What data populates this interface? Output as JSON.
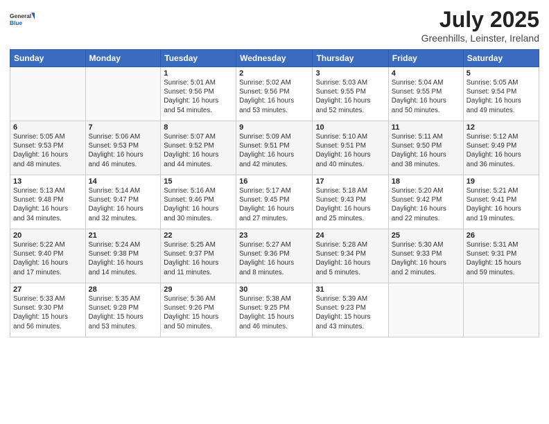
{
  "header": {
    "month_title": "July 2025",
    "location": "Greenhills, Leinster, Ireland"
  },
  "columns": [
    "Sunday",
    "Monday",
    "Tuesday",
    "Wednesday",
    "Thursday",
    "Friday",
    "Saturday"
  ],
  "weeks": [
    [
      {
        "day": "",
        "detail": ""
      },
      {
        "day": "",
        "detail": ""
      },
      {
        "day": "1",
        "detail": "Sunrise: 5:01 AM\nSunset: 9:56 PM\nDaylight: 16 hours\nand 54 minutes."
      },
      {
        "day": "2",
        "detail": "Sunrise: 5:02 AM\nSunset: 9:56 PM\nDaylight: 16 hours\nand 53 minutes."
      },
      {
        "day": "3",
        "detail": "Sunrise: 5:03 AM\nSunset: 9:55 PM\nDaylight: 16 hours\nand 52 minutes."
      },
      {
        "day": "4",
        "detail": "Sunrise: 5:04 AM\nSunset: 9:55 PM\nDaylight: 16 hours\nand 50 minutes."
      },
      {
        "day": "5",
        "detail": "Sunrise: 5:05 AM\nSunset: 9:54 PM\nDaylight: 16 hours\nand 49 minutes."
      }
    ],
    [
      {
        "day": "6",
        "detail": "Sunrise: 5:05 AM\nSunset: 9:53 PM\nDaylight: 16 hours\nand 48 minutes."
      },
      {
        "day": "7",
        "detail": "Sunrise: 5:06 AM\nSunset: 9:53 PM\nDaylight: 16 hours\nand 46 minutes."
      },
      {
        "day": "8",
        "detail": "Sunrise: 5:07 AM\nSunset: 9:52 PM\nDaylight: 16 hours\nand 44 minutes."
      },
      {
        "day": "9",
        "detail": "Sunrise: 5:09 AM\nSunset: 9:51 PM\nDaylight: 16 hours\nand 42 minutes."
      },
      {
        "day": "10",
        "detail": "Sunrise: 5:10 AM\nSunset: 9:51 PM\nDaylight: 16 hours\nand 40 minutes."
      },
      {
        "day": "11",
        "detail": "Sunrise: 5:11 AM\nSunset: 9:50 PM\nDaylight: 16 hours\nand 38 minutes."
      },
      {
        "day": "12",
        "detail": "Sunrise: 5:12 AM\nSunset: 9:49 PM\nDaylight: 16 hours\nand 36 minutes."
      }
    ],
    [
      {
        "day": "13",
        "detail": "Sunrise: 5:13 AM\nSunset: 9:48 PM\nDaylight: 16 hours\nand 34 minutes."
      },
      {
        "day": "14",
        "detail": "Sunrise: 5:14 AM\nSunset: 9:47 PM\nDaylight: 16 hours\nand 32 minutes."
      },
      {
        "day": "15",
        "detail": "Sunrise: 5:16 AM\nSunset: 9:46 PM\nDaylight: 16 hours\nand 30 minutes."
      },
      {
        "day": "16",
        "detail": "Sunrise: 5:17 AM\nSunset: 9:45 PM\nDaylight: 16 hours\nand 27 minutes."
      },
      {
        "day": "17",
        "detail": "Sunrise: 5:18 AM\nSunset: 9:43 PM\nDaylight: 16 hours\nand 25 minutes."
      },
      {
        "day": "18",
        "detail": "Sunrise: 5:20 AM\nSunset: 9:42 PM\nDaylight: 16 hours\nand 22 minutes."
      },
      {
        "day": "19",
        "detail": "Sunrise: 5:21 AM\nSunset: 9:41 PM\nDaylight: 16 hours\nand 19 minutes."
      }
    ],
    [
      {
        "day": "20",
        "detail": "Sunrise: 5:22 AM\nSunset: 9:40 PM\nDaylight: 16 hours\nand 17 minutes."
      },
      {
        "day": "21",
        "detail": "Sunrise: 5:24 AM\nSunset: 9:38 PM\nDaylight: 16 hours\nand 14 minutes."
      },
      {
        "day": "22",
        "detail": "Sunrise: 5:25 AM\nSunset: 9:37 PM\nDaylight: 16 hours\nand 11 minutes."
      },
      {
        "day": "23",
        "detail": "Sunrise: 5:27 AM\nSunset: 9:36 PM\nDaylight: 16 hours\nand 8 minutes."
      },
      {
        "day": "24",
        "detail": "Sunrise: 5:28 AM\nSunset: 9:34 PM\nDaylight: 16 hours\nand 5 minutes."
      },
      {
        "day": "25",
        "detail": "Sunrise: 5:30 AM\nSunset: 9:33 PM\nDaylight: 16 hours\nand 2 minutes."
      },
      {
        "day": "26",
        "detail": "Sunrise: 5:31 AM\nSunset: 9:31 PM\nDaylight: 15 hours\nand 59 minutes."
      }
    ],
    [
      {
        "day": "27",
        "detail": "Sunrise: 5:33 AM\nSunset: 9:30 PM\nDaylight: 15 hours\nand 56 minutes."
      },
      {
        "day": "28",
        "detail": "Sunrise: 5:35 AM\nSunset: 9:28 PM\nDaylight: 15 hours\nand 53 minutes."
      },
      {
        "day": "29",
        "detail": "Sunrise: 5:36 AM\nSunset: 9:26 PM\nDaylight: 15 hours\nand 50 minutes."
      },
      {
        "day": "30",
        "detail": "Sunrise: 5:38 AM\nSunset: 9:25 PM\nDaylight: 15 hours\nand 46 minutes."
      },
      {
        "day": "31",
        "detail": "Sunrise: 5:39 AM\nSunset: 9:23 PM\nDaylight: 15 hours\nand 43 minutes."
      },
      {
        "day": "",
        "detail": ""
      },
      {
        "day": "",
        "detail": ""
      }
    ]
  ]
}
